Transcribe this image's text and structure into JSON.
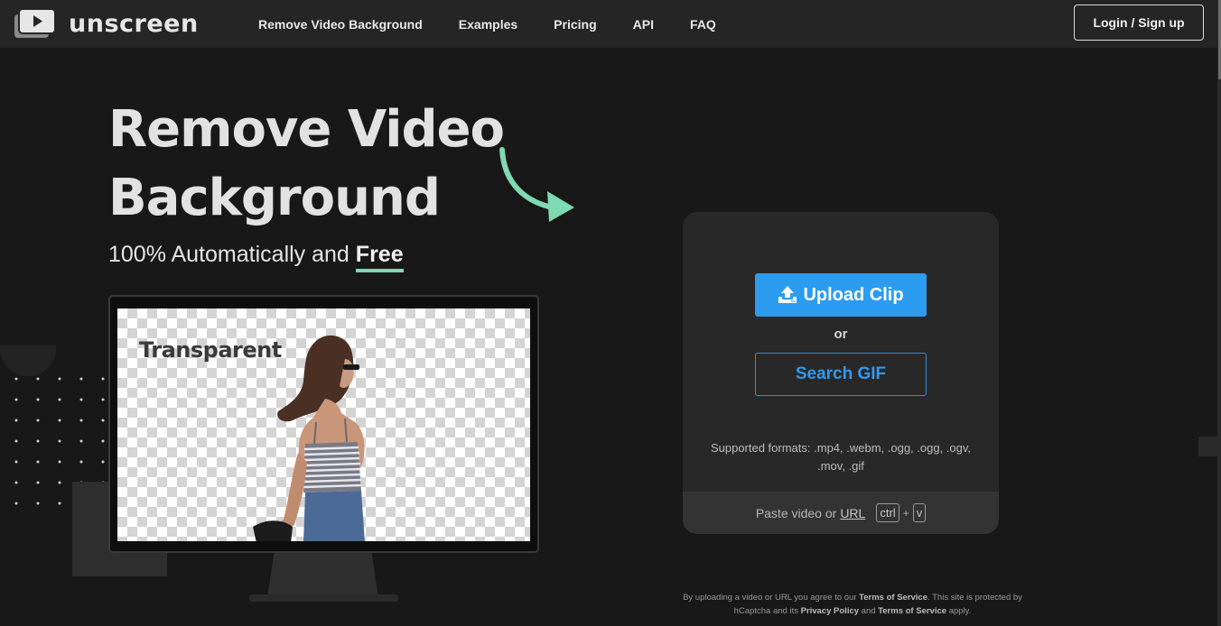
{
  "brand": {
    "name": "unscreen"
  },
  "nav": {
    "links": [
      "Remove Video Background",
      "Examples",
      "Pricing",
      "API",
      "FAQ"
    ],
    "login_label": "Login / Sign up"
  },
  "hero": {
    "title_line1": "Remove Video",
    "title_line2": "Background",
    "subtitle_prefix": "100% Automatically and",
    "subtitle_highlight": "Free"
  },
  "demo": {
    "label": "Transparent"
  },
  "upload": {
    "upload_label": "Upload Clip",
    "or_label": "or",
    "search_label": "Search GIF",
    "formats_line1": "Supported formats: .mp4, .webm, .ogg, .ogg, .ogv,",
    "formats_line2": ".mov, .gif",
    "paste_prefix": "Paste video or",
    "paste_url": "URL",
    "key_ctrl": "ctrl",
    "key_plus": "+",
    "key_v": "v"
  },
  "terms": {
    "t1": "By uploading a video or URL you agree to our",
    "link_tos": "Terms of Service",
    "t2": ". This site is protected by hCaptcha and its",
    "link_privacy": "Privacy Policy",
    "t3": "and",
    "link_tos2": "Terms of Service",
    "t4": "apply."
  },
  "colors": {
    "accent": "#2c9cf0",
    "highlight": "#7fd9b2",
    "background": "#181818",
    "navbar": "#252525",
    "card": "#282828"
  },
  "icons": {
    "logo": "video-play-icon",
    "upload": "upload-icon",
    "arrow": "curved-arrow-icon"
  }
}
